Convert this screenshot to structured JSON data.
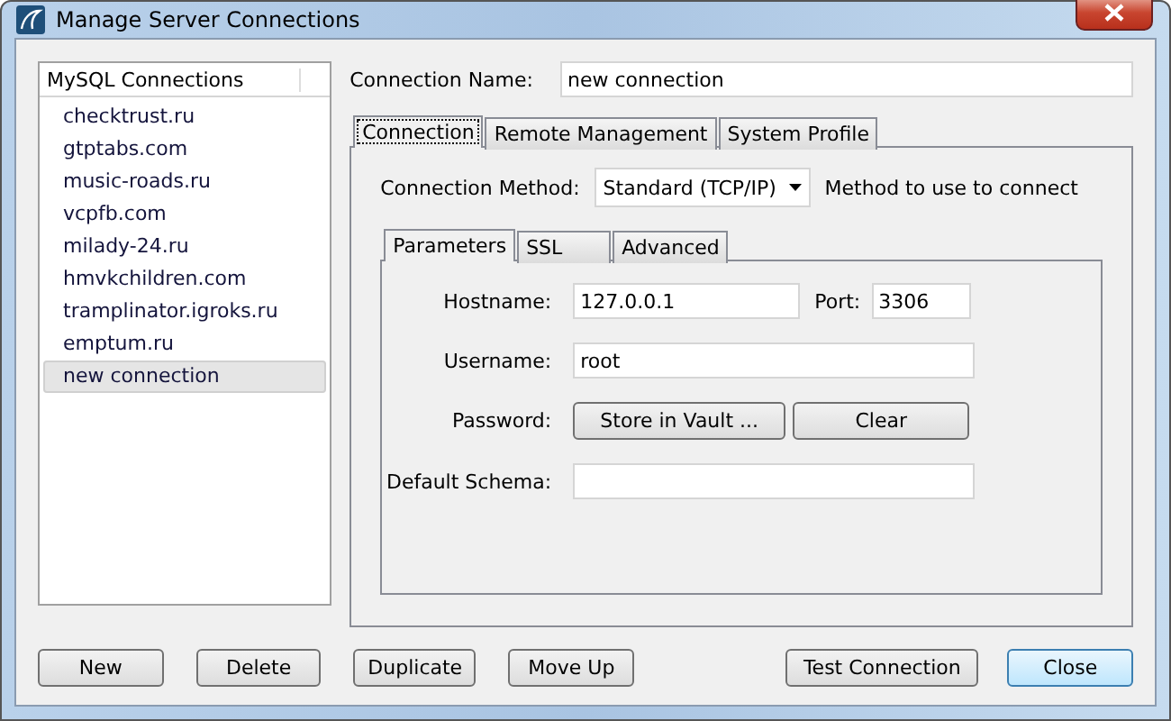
{
  "window": {
    "title": "Manage Server Connections"
  },
  "connections": {
    "heading": "MySQL Connections",
    "items": [
      {
        "label": "checktrust.ru",
        "selected": false
      },
      {
        "label": "gtptabs.com",
        "selected": false
      },
      {
        "label": "music-roads.ru",
        "selected": false
      },
      {
        "label": "vcpfb.com",
        "selected": false
      },
      {
        "label": "milady-24.ru",
        "selected": false
      },
      {
        "label": "hmvkchildren.com",
        "selected": false
      },
      {
        "label": "tramplinator.igroks.ru",
        "selected": false
      },
      {
        "label": "emptum.ru",
        "selected": false
      },
      {
        "label": "new connection",
        "selected": true
      }
    ]
  },
  "connection_name": {
    "label": "Connection Name:",
    "value": "new connection"
  },
  "tabs": [
    {
      "label": "Connection",
      "selected": true
    },
    {
      "label": "Remote Management",
      "selected": false
    },
    {
      "label": "System Profile",
      "selected": false
    }
  ],
  "method": {
    "label": "Connection Method:",
    "value": "Standard (TCP/IP)",
    "hint": "Method to use to connect"
  },
  "sub_tabs": [
    {
      "label": "Parameters",
      "selected": true
    },
    {
      "label": "SSL",
      "selected": false
    },
    {
      "label": "Advanced",
      "selected": false
    }
  ],
  "parameters": {
    "hostname": {
      "label": "Hostname:",
      "value": "127.0.0.1"
    },
    "port": {
      "label": "Port:",
      "value": "3306"
    },
    "username": {
      "label": "Username:",
      "value": "root"
    },
    "password": {
      "label": "Password:",
      "buttons": [
        "Store in Vault ...",
        "Clear"
      ]
    },
    "schema": {
      "label": "Default Schema:"
    }
  },
  "buttons": [
    {
      "label": "New",
      "default": false
    },
    {
      "label": "Delete",
      "default": false
    },
    {
      "label": "Duplicate",
      "default": false
    },
    {
      "label": "Move Up",
      "default": false
    },
    {
      "label": "Test Connection",
      "default": false
    },
    {
      "label": "Close",
      "default": true
    }
  ]
}
